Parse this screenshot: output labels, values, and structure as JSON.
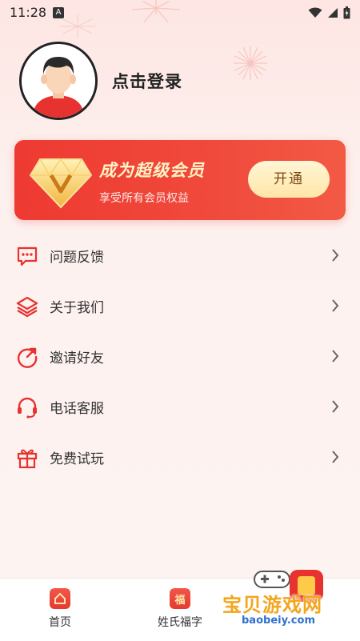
{
  "status_bar": {
    "time": "11:28",
    "notification_letter": "A"
  },
  "profile": {
    "login_text": "点击登录"
  },
  "vip": {
    "title": "成为超级会员",
    "subtitle": "享受所有会员权益",
    "button_label": "开通"
  },
  "menu": {
    "items": [
      {
        "label": "问题反馈",
        "icon": "feedback-icon"
      },
      {
        "label": "关于我们",
        "icon": "layers-icon"
      },
      {
        "label": "邀请好友",
        "icon": "share-icon"
      },
      {
        "label": "电话客服",
        "icon": "headset-icon"
      },
      {
        "label": "免费试玩",
        "icon": "gift-icon"
      }
    ]
  },
  "bottom_nav": {
    "items": [
      {
        "label": "首页",
        "icon": "home-icon"
      },
      {
        "label": "姓氏福字",
        "icon": "fu-icon",
        "icon_text": "福"
      }
    ]
  },
  "watermark": {
    "text": "宝贝游戏网",
    "url": "baobeiy.com"
  },
  "colors": {
    "accent": "#ee3a32",
    "gold_text": "#fff3c4",
    "watermark_text": "#f3a51c"
  }
}
